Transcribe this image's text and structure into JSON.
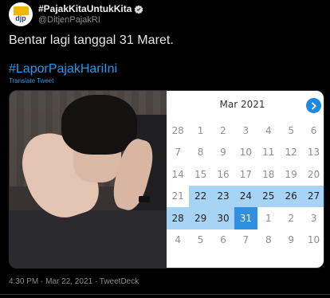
{
  "account": {
    "display_name": "#PajakKitaUntukKita",
    "handle": "@DitjenPajakRI",
    "avatar_text": "djp"
  },
  "tweet": {
    "text": "Bentar lagi tanggal 31 Maret.",
    "hashtag": "#LaporPajakHariIni",
    "translate_label": "Translate Tweet"
  },
  "calendar": {
    "title": "Mar 2021",
    "weeks": [
      [
        {
          "d": "28",
          "s": "muted"
        },
        {
          "d": "1",
          "s": "muted"
        },
        {
          "d": "2",
          "s": "muted"
        },
        {
          "d": "3",
          "s": "muted"
        },
        {
          "d": "4",
          "s": "muted"
        },
        {
          "d": "5",
          "s": "muted"
        },
        {
          "d": "6",
          "s": "muted"
        }
      ],
      [
        {
          "d": "7",
          "s": "muted"
        },
        {
          "d": "8",
          "s": "muted"
        },
        {
          "d": "9",
          "s": "muted"
        },
        {
          "d": "10",
          "s": "muted"
        },
        {
          "d": "11",
          "s": "muted"
        },
        {
          "d": "12",
          "s": "muted"
        },
        {
          "d": "13",
          "s": "muted"
        }
      ],
      [
        {
          "d": "14",
          "s": "muted"
        },
        {
          "d": "15",
          "s": "muted"
        },
        {
          "d": "16",
          "s": "muted"
        },
        {
          "d": "17",
          "s": "muted"
        },
        {
          "d": "18",
          "s": "muted"
        },
        {
          "d": "19",
          "s": "muted"
        },
        {
          "d": "20",
          "s": "muted"
        }
      ],
      [
        {
          "d": "21",
          "s": "muted"
        },
        {
          "d": "22",
          "s": "range"
        },
        {
          "d": "23",
          "s": "range"
        },
        {
          "d": "24",
          "s": "range"
        },
        {
          "d": "25",
          "s": "range"
        },
        {
          "d": "26",
          "s": "range"
        },
        {
          "d": "27",
          "s": "range"
        }
      ],
      [
        {
          "d": "28",
          "s": "range"
        },
        {
          "d": "29",
          "s": "range"
        },
        {
          "d": "30",
          "s": "range"
        },
        {
          "d": "31",
          "s": "selected"
        },
        {
          "d": "1",
          "s": "muted"
        },
        {
          "d": "2",
          "s": "muted"
        },
        {
          "d": "3",
          "s": "muted"
        }
      ],
      [
        {
          "d": "4",
          "s": "muted"
        },
        {
          "d": "5",
          "s": "muted"
        },
        {
          "d": "6",
          "s": "muted"
        },
        {
          "d": "7",
          "s": "muted"
        },
        {
          "d": "8",
          "s": "muted"
        },
        {
          "d": "9",
          "s": "muted"
        },
        {
          "d": "10",
          "s": "muted"
        }
      ]
    ]
  },
  "footer": {
    "meta": "4:30 PM · Mar 22, 2021 · TweetDeck"
  },
  "colors": {
    "link": "#1d9bf0",
    "selected_day": "#2f8fe0",
    "range_day": "#a7d4f5",
    "verified": "#d9d9d9"
  }
}
